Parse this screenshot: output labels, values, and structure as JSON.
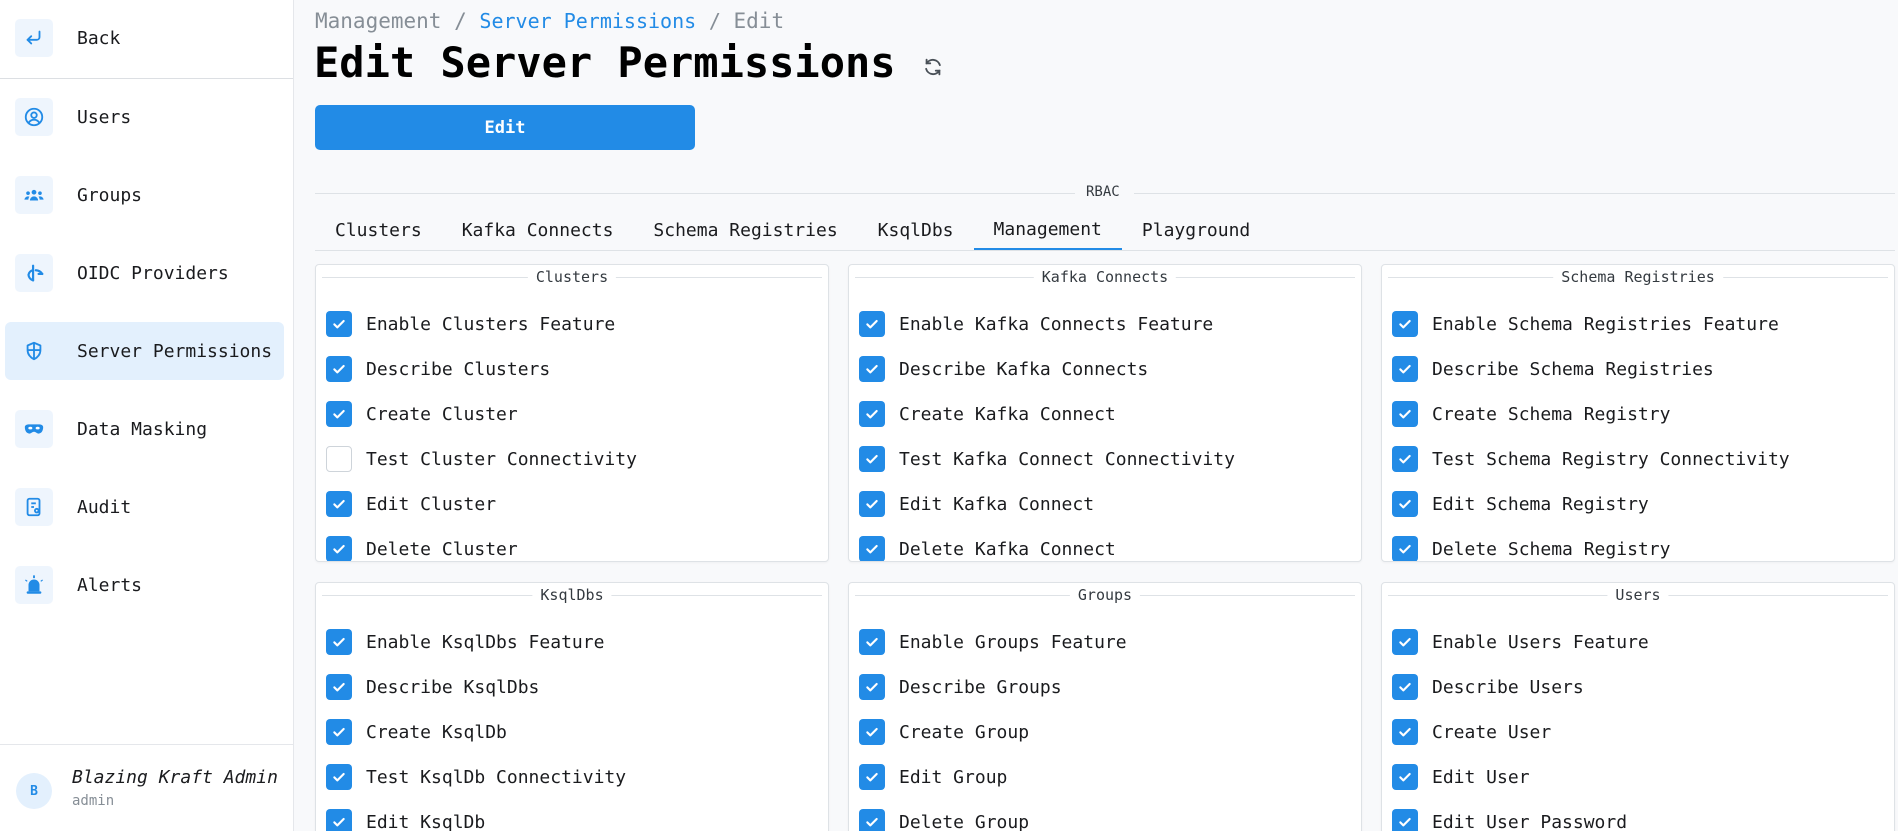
{
  "sidebar": {
    "back_label": "Back",
    "items": [
      {
        "label": "Users",
        "icon": "user-circle-icon"
      },
      {
        "label": "Groups",
        "icon": "users-group-icon"
      },
      {
        "label": "OIDC Providers",
        "icon": "oidc-icon"
      },
      {
        "label": "Server Permissions",
        "icon": "shield-icon",
        "active": true
      },
      {
        "label": "Data Masking",
        "icon": "mask-icon"
      },
      {
        "label": "Audit",
        "icon": "report-icon"
      },
      {
        "label": "Alerts",
        "icon": "alarm-icon"
      }
    ],
    "user": {
      "avatar": "B",
      "name": "Blazing Kraft Admin",
      "role": "admin"
    }
  },
  "breadcrumb": {
    "root": "Management",
    "sep1": "/",
    "link": "Server Permissions",
    "sep2": "/",
    "current": "Edit"
  },
  "page": {
    "title": "Edit Server Permissions",
    "edit_button": "Edit"
  },
  "rbac": {
    "label": "RBAC",
    "tabs": [
      "Clusters",
      "Kafka Connects",
      "Schema Registries",
      "KsqlDbs",
      "Management",
      "Playground"
    ],
    "active_tab": "Management"
  },
  "panels": [
    {
      "title": "Clusters",
      "items": [
        {
          "label": "Enable Clusters Feature",
          "checked": true
        },
        {
          "label": "Describe Clusters",
          "checked": true
        },
        {
          "label": "Create Cluster",
          "checked": true
        },
        {
          "label": "Test Cluster Connectivity",
          "checked": false
        },
        {
          "label": "Edit Cluster",
          "checked": true
        },
        {
          "label": "Delete Cluster",
          "checked": true
        }
      ]
    },
    {
      "title": "Kafka Connects",
      "items": [
        {
          "label": "Enable Kafka Connects Feature",
          "checked": true
        },
        {
          "label": "Describe Kafka Connects",
          "checked": true
        },
        {
          "label": "Create Kafka Connect",
          "checked": true
        },
        {
          "label": "Test Kafka Connect Connectivity",
          "checked": true
        },
        {
          "label": "Edit Kafka Connect",
          "checked": true
        },
        {
          "label": "Delete Kafka Connect",
          "checked": true
        }
      ]
    },
    {
      "title": "Schema Registries",
      "items": [
        {
          "label": "Enable Schema Registries Feature",
          "checked": true
        },
        {
          "label": "Describe Schema Registries",
          "checked": true
        },
        {
          "label": "Create Schema Registry",
          "checked": true
        },
        {
          "label": "Test Schema Registry Connectivity",
          "checked": true
        },
        {
          "label": "Edit Schema Registry",
          "checked": true
        },
        {
          "label": "Delete Schema Registry",
          "checked": true
        }
      ]
    },
    {
      "title": "KsqlDbs",
      "items": [
        {
          "label": "Enable KsqlDbs Feature",
          "checked": true
        },
        {
          "label": "Describe KsqlDbs",
          "checked": true
        },
        {
          "label": "Create KsqlDb",
          "checked": true
        },
        {
          "label": "Test KsqlDb Connectivity",
          "checked": true
        },
        {
          "label": "Edit KsqlDb",
          "checked": true
        }
      ]
    },
    {
      "title": "Groups",
      "items": [
        {
          "label": "Enable Groups Feature",
          "checked": true
        },
        {
          "label": "Describe Groups",
          "checked": true
        },
        {
          "label": "Create Group",
          "checked": true
        },
        {
          "label": "Edit Group",
          "checked": true
        },
        {
          "label": "Delete Group",
          "checked": true
        }
      ]
    },
    {
      "title": "Users",
      "items": [
        {
          "label": "Enable Users Feature",
          "checked": true
        },
        {
          "label": "Describe Users",
          "checked": true
        },
        {
          "label": "Create User",
          "checked": true
        },
        {
          "label": "Edit User",
          "checked": true
        },
        {
          "label": "Edit User Password",
          "checked": true
        }
      ]
    }
  ],
  "colors": {
    "accent": "#228be6",
    "active_bg": "#e3f0fd"
  }
}
